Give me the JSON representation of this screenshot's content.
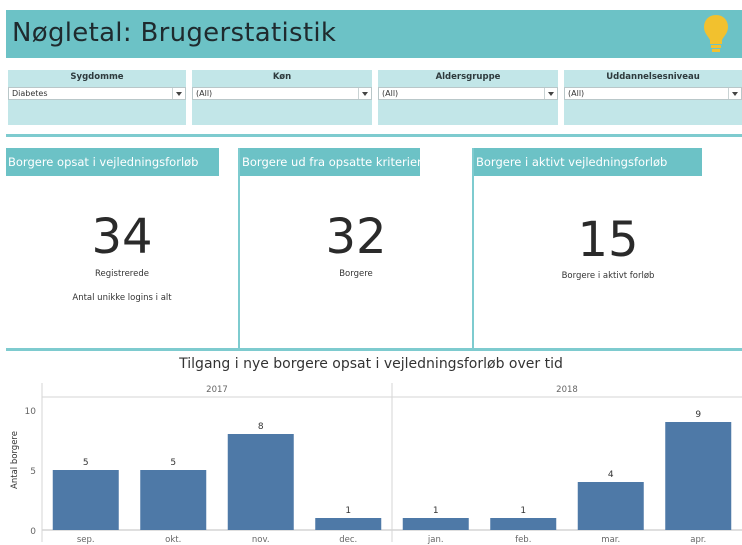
{
  "header": {
    "title": "Nøgletal: Brugerstatistik",
    "icon": "lightbulb-icon",
    "accent": "#6cc2c6"
  },
  "filters": [
    {
      "label": "Sygdomme",
      "value": "Diabetes"
    },
    {
      "label": "Køn",
      "value": "(All)"
    },
    {
      "label": "Aldersgruppe",
      "value": "(All)"
    },
    {
      "label": "Uddannelsesniveau",
      "value": "(All)"
    }
  ],
  "cards": [
    {
      "title": "Borgere opsat i vejledningsforløb",
      "value": "34",
      "caption": "Registrerede",
      "note": "Antal unikke logins i alt"
    },
    {
      "title": "Borgere ud fra opsatte kriterier",
      "value": "32",
      "caption": "Borgere"
    },
    {
      "title": "Borgere i aktivt vejledningsforløb",
      "value": "15",
      "caption": "Borgere i aktivt forløb"
    }
  ],
  "chart_data": {
    "type": "bar",
    "title": "Tilgang i nye borgere opsat i vejledningsforløb over tid",
    "ylabel": "Antal borgere",
    "ylim": [
      0,
      10
    ],
    "yticks": [
      0,
      5,
      10
    ],
    "bar_color": "#4e79a7",
    "panels": [
      {
        "year": "2017",
        "categories": [
          "sep.",
          "okt.",
          "nov.",
          "dec."
        ],
        "values": [
          5,
          5,
          8,
          1
        ]
      },
      {
        "year": "2018",
        "categories": [
          "jan.",
          "feb.",
          "mar.",
          "apr."
        ],
        "values": [
          1,
          1,
          4,
          9
        ]
      }
    ]
  }
}
